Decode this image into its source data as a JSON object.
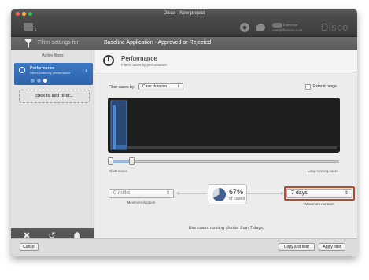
{
  "window": {
    "title": "Disco - New project"
  },
  "toolbar": {
    "doc_count": "1",
    "account_line1": "Enterprise",
    "account_line2": "user@fluxicon.com",
    "logo": "Disco"
  },
  "filter_bar": {
    "prefix": "Filter settings for:",
    "name": "Baseline Application - Approved or Rejected"
  },
  "sidebar": {
    "header": "Active filters",
    "items": [
      {
        "title": "Performance",
        "subtitle": "Filters cases by performance"
      }
    ],
    "add_filter_label": "click to add filter...",
    "bottom_buttons": [
      {
        "label": "Reset",
        "icon": "close-icon"
      },
      {
        "label": "Undo changes",
        "icon": "undo-icon"
      },
      {
        "label": "Recipe",
        "icon": "recipe-icon"
      }
    ]
  },
  "main": {
    "title": "Performance",
    "subtitle": "Filters cases by performance",
    "filter_by_label": "Filter cases by:",
    "filter_by_value": "Case duration",
    "extend_range_label": "Extend range",
    "extend_range_checked": false,
    "short_cases_label": "Short cases",
    "long_cases_label": "Long-running cases",
    "min_value": "0 millis",
    "min_label": "Minimum duration",
    "max_value": "7 days",
    "max_label": "Maximum duration",
    "percent": "67%",
    "percent_fraction": 0.67,
    "percent_sub": "of cases",
    "summary": "Use cases running shorter than 7 days."
  },
  "histogram": {
    "selected_fraction": 0.09
  },
  "footer": {
    "cancel": "Cancel",
    "copy_and_filter": "Copy and filter",
    "apply_filter": "Apply filter"
  },
  "colors": {
    "accent": "#2d63ad",
    "highlight_border": "#c1462c",
    "pie_fill": "#3f5f8f"
  }
}
